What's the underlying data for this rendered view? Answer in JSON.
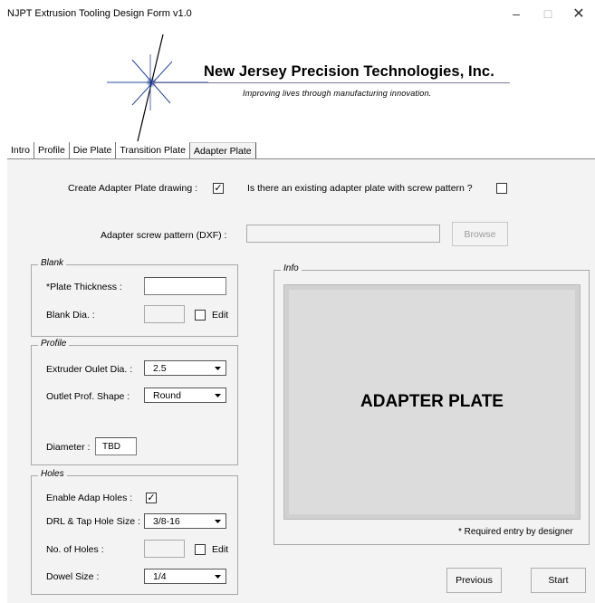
{
  "window": {
    "title": "NJPT Extrusion Tooling Design Form v1.0",
    "minimize": "–",
    "maximize": "□",
    "close": "✕"
  },
  "logo": {
    "company": "New Jersey Precision Technologies, Inc.",
    "tagline": "Improving lives through manufacturing innovation."
  },
  "tabs": [
    "Intro",
    "Profile",
    "Die Plate",
    "Transition Plate",
    "Adapter Plate"
  ],
  "active_tab": "Adapter Plate",
  "top": {
    "create_label": "Create Adapter Plate drawing :",
    "create_checked": true,
    "existing_label": "Is there an existing adapter plate with screw pattern ?",
    "existing_checked": false,
    "screw_pattern_label": "Adapter screw pattern (DXF) :",
    "screw_pattern_value": "",
    "browse_label": "Browse"
  },
  "blank": {
    "caption": "Blank",
    "thickness_label": "*Plate Thickness :",
    "thickness_value": "",
    "dia_label": "Blank Dia. :",
    "dia_value": "",
    "edit_label": "Edit",
    "edit_checked": false
  },
  "profile": {
    "caption": "Profile",
    "outlet_dia_label": "Extruder Oulet Dia. :",
    "outlet_dia_value": "2.5",
    "shape_label": "Outlet Prof. Shape :",
    "shape_value": "Round",
    "diameter_label": "Diameter :",
    "diameter_value": "TBD"
  },
  "holes": {
    "caption": "Holes",
    "enable_label": "Enable Adap Holes :",
    "enable_checked": true,
    "tap_label": "DRL & Tap Hole Size :",
    "tap_value": "3/8-16",
    "count_label": "No. of Holes :",
    "count_value": "",
    "edit_label": "Edit",
    "edit_checked": false,
    "dowel_label": "Dowel Size :",
    "dowel_value": "1/4"
  },
  "info": {
    "caption": "Info",
    "preview_text": "ADAPTER PLATE",
    "required_note": "* Required entry by designer"
  },
  "buttons": {
    "previous": "Previous",
    "start": "Start"
  }
}
